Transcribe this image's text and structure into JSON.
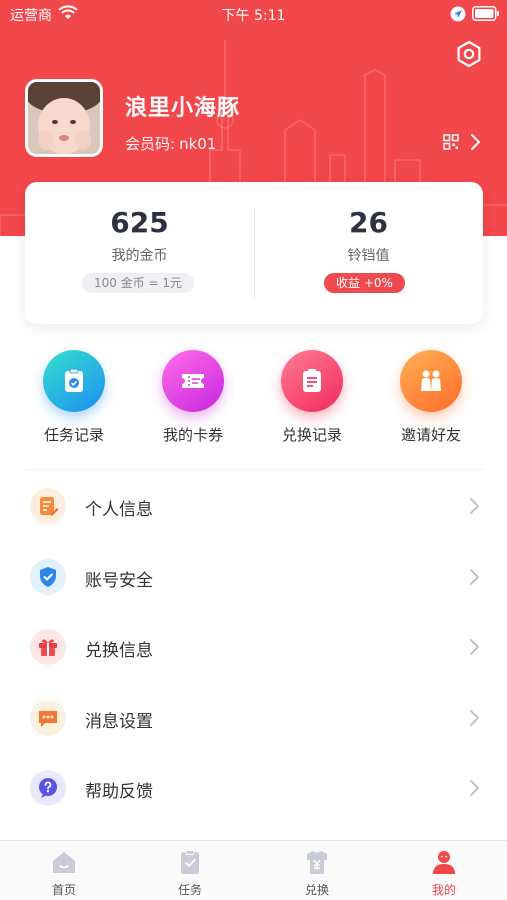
{
  "status_bar": {
    "carrier": "运营商",
    "time": "下午 5:11"
  },
  "profile": {
    "username": "浪里小海豚",
    "member_code_label": "会员码:",
    "member_code": "nk01"
  },
  "stats": {
    "coins_value": "625",
    "coins_label": "我的金币",
    "coins_note": "100 金币 = 1元",
    "bells_value": "26",
    "bells_label": "铃铛值",
    "bells_note": "收益 +0%"
  },
  "quick_actions": [
    {
      "label": "任务记录",
      "icon": "task-record-icon"
    },
    {
      "label": "我的卡券",
      "icon": "ticket-icon"
    },
    {
      "label": "兑换记录",
      "icon": "exchange-record-icon"
    },
    {
      "label": "邀请好友",
      "icon": "invite-friends-icon"
    }
  ],
  "menu": [
    {
      "label": "个人信息",
      "icon": "personal-info-icon"
    },
    {
      "label": "账号安全",
      "icon": "shield-icon"
    },
    {
      "label": "兑换信息",
      "icon": "gift-icon"
    },
    {
      "label": "消息设置",
      "icon": "message-icon"
    },
    {
      "label": "帮助反馈",
      "icon": "help-icon"
    }
  ],
  "tabbar": [
    {
      "label": "首页",
      "icon": "home-icon"
    },
    {
      "label": "任务",
      "icon": "task-icon"
    },
    {
      "label": "兑换",
      "icon": "exchange-icon"
    },
    {
      "label": "我的",
      "icon": "profile-icon",
      "active": true
    }
  ],
  "colors": {
    "brand_red": "#f2474b",
    "text_dark": "#2d3142",
    "tab_inactive": "#555555"
  }
}
